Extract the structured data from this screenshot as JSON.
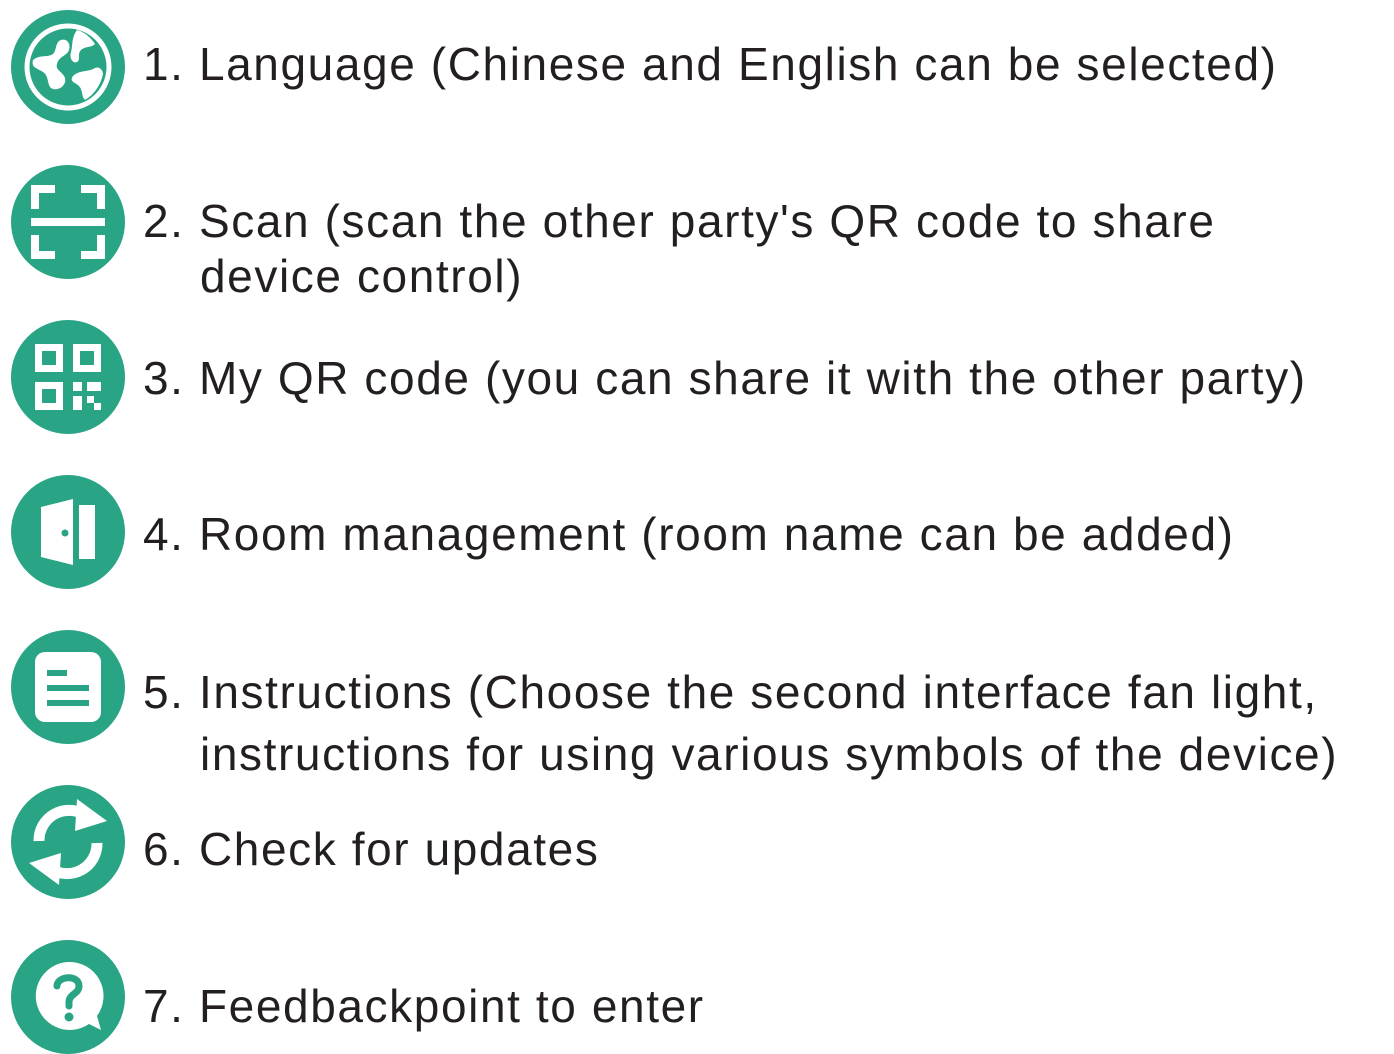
{
  "accent_color": "#29a585",
  "items": [
    {
      "icon": "globe-icon",
      "lines": [
        "1. Language (Chinese and English can be selected)"
      ]
    },
    {
      "icon": "scan-icon",
      "lines": [
        "2. Scan (scan the other party's QR code to share",
        "device control)"
      ]
    },
    {
      "icon": "qr-code-icon",
      "lines": [
        "3. My QR code (you can share it with the other party)"
      ]
    },
    {
      "icon": "door-icon",
      "lines": [
        "4. Room management (room name can be added)"
      ]
    },
    {
      "icon": "document-icon",
      "lines": [
        "5. Instructions (Choose the second interface fan light,",
        "instructions for using various symbols of the device)"
      ]
    },
    {
      "icon": "refresh-icon",
      "lines": [
        "6. Check for updates"
      ]
    },
    {
      "icon": "feedback-question-icon",
      "lines": [
        "7. Feedbackpoint to enter"
      ]
    }
  ]
}
